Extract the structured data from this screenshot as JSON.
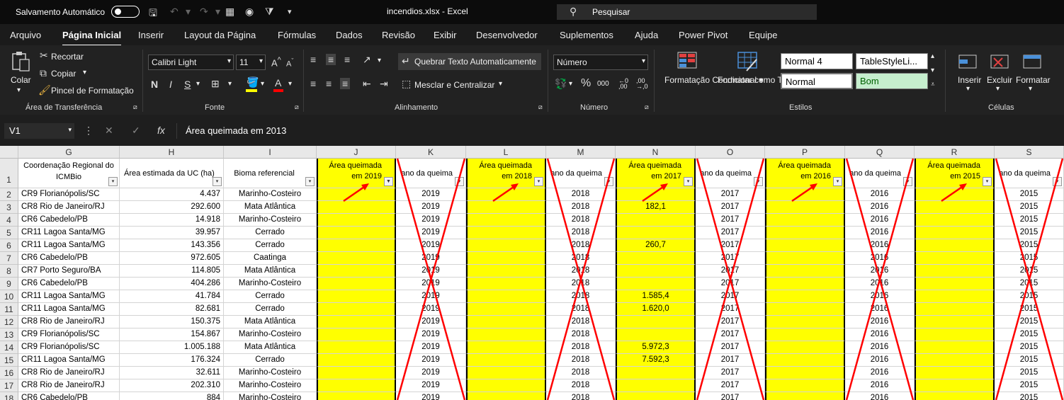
{
  "titlebar": {
    "autosave_label": "Salvamento Automático",
    "file_title": "incendios.xlsx  -  Excel",
    "search_placeholder": "Pesquisar"
  },
  "menu": [
    "Arquivo",
    "Página Inicial",
    "Inserir",
    "Layout da Página",
    "Fórmulas",
    "Dados",
    "Revisão",
    "Exibir",
    "Desenvolvedor",
    "Suplementos",
    "Ajuda",
    "Power Pivot",
    "Equipe"
  ],
  "menu_active": "Página Inicial",
  "ribbon": {
    "clipboard": {
      "paste": "Colar",
      "cut": "Recortar",
      "copy": "Copiar",
      "format_painter": "Pincel de Formatação",
      "label": "Área de Transferência"
    },
    "font": {
      "name": "Calibri Light",
      "size": "11",
      "label": "Fonte"
    },
    "alignment": {
      "wrap": "Quebrar Texto Automaticamente",
      "merge": "Mesclar e Centralizar",
      "label": "Alinhamento"
    },
    "number": {
      "format": "Número",
      "label": "Número"
    },
    "styles": {
      "conditional": "Formatação Condicional",
      "as_table": "Formatar como Tabela",
      "normal4": "Normal 4",
      "tablestyle": "TableStyleLi...",
      "normal": "Normal",
      "bom": "Bom",
      "label": "Estilos"
    },
    "cells": {
      "insert": "Inserir",
      "delete": "Excluir",
      "format": "Formatar",
      "label": "Células"
    }
  },
  "formula_bar": {
    "name_box": "V1",
    "content": "Área queimada em 2013"
  },
  "columns": [
    {
      "letter": "G",
      "header": "Coordenação Regional do ICMBio"
    },
    {
      "letter": "H",
      "header": "Área estimada da UC (ha)"
    },
    {
      "letter": "I",
      "header": "Bioma referencial"
    },
    {
      "letter": "J",
      "header": "Área queimada em 2019"
    },
    {
      "letter": "K",
      "header": "ano da  queima"
    },
    {
      "letter": "L",
      "header": "Área queimada em 2018"
    },
    {
      "letter": "M",
      "header": "ano da  queima"
    },
    {
      "letter": "N",
      "header": "Área queimada em 2017"
    },
    {
      "letter": "O",
      "header": "ano da  queima"
    },
    {
      "letter": "P",
      "header": "Área queimada em 2016"
    },
    {
      "letter": "Q",
      "header": "ano da  queima"
    },
    {
      "letter": "R",
      "header": "Área queimada em 2015"
    },
    {
      "letter": "S",
      "header": "ano da  queima"
    }
  ],
  "rows": [
    {
      "n": "2",
      "g": "CR9 Florianópolis/SC",
      "h": "4.437",
      "i": "Marinho-Costeiro",
      "n_val": ""
    },
    {
      "n": "3",
      "g": "CR8 Rio de Janeiro/RJ",
      "h": "292.600",
      "i": "Mata Atlântica",
      "n_val": "182,1"
    },
    {
      "n": "4",
      "g": "CR6 Cabedelo/PB",
      "h": "14.918",
      "i": "Marinho-Costeiro",
      "n_val": ""
    },
    {
      "n": "5",
      "g": "CR11 Lagoa Santa/MG",
      "h": "39.957",
      "i": "Cerrado",
      "n_val": ""
    },
    {
      "n": "6",
      "g": "CR11 Lagoa Santa/MG",
      "h": "143.356",
      "i": "Cerrado",
      "n_val": "260,7"
    },
    {
      "n": "7",
      "g": "CR6 Cabedelo/PB",
      "h": "972.605",
      "i": "Caatinga",
      "n_val": ""
    },
    {
      "n": "8",
      "g": "CR7 Porto Seguro/BA",
      "h": "114.805",
      "i": "Mata Atlântica",
      "n_val": ""
    },
    {
      "n": "9",
      "g": "CR6 Cabedelo/PB",
      "h": "404.286",
      "i": "Marinho-Costeiro",
      "n_val": ""
    },
    {
      "n": "10",
      "g": "CR11 Lagoa Santa/MG",
      "h": "41.784",
      "i": "Cerrado",
      "n_val": "1.585,4"
    },
    {
      "n": "11",
      "g": "CR11 Lagoa Santa/MG",
      "h": "82.681",
      "i": "Cerrado",
      "n_val": "1.620,0"
    },
    {
      "n": "12",
      "g": "CR8 Rio de Janeiro/RJ",
      "h": "150.375",
      "i": "Mata Atlântica",
      "n_val": ""
    },
    {
      "n": "13",
      "g": "CR9 Florianópolis/SC",
      "h": "154.867",
      "i": "Marinho-Costeiro",
      "n_val": ""
    },
    {
      "n": "14",
      "g": "CR9 Florianópolis/SC",
      "h": "1.005.188",
      "i": "Mata Atlântica",
      "n_val": "5.972,3"
    },
    {
      "n": "15",
      "g": "CR11 Lagoa Santa/MG",
      "h": "176.324",
      "i": "Cerrado",
      "n_val": "7.592,3"
    },
    {
      "n": "16",
      "g": "CR8 Rio de Janeiro/RJ",
      "h": "32.611",
      "i": "Marinho-Costeiro",
      "n_val": ""
    },
    {
      "n": "17",
      "g": "CR8 Rio de Janeiro/RJ",
      "h": "202.310",
      "i": "Marinho-Costeiro",
      "n_val": ""
    },
    {
      "n": "18",
      "g": "CR6 Cabedelo/PB",
      "h": "884",
      "i": "Marinho-Costeiro",
      "n_val": ""
    }
  ],
  "year_columns": {
    "K": "2019",
    "M": "2018",
    "O": "2017",
    "Q": "2016",
    "S": "2015"
  },
  "colors": {
    "highlight": "#ffff00",
    "annotation": "#ff0000",
    "bom_bg": "#c6efce",
    "bom_text": "#006100"
  }
}
